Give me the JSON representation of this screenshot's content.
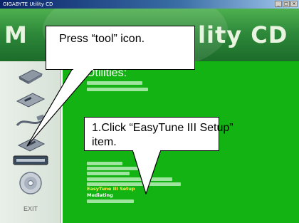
{
  "window": {
    "title": "GIGABYTE Utility CD",
    "buttons": [
      "_",
      "□",
      "×"
    ]
  },
  "banner": {
    "text_left": "M",
    "text_right": "lity CD",
    "colors": {
      "top": "#4fb04f",
      "bottom": "#1c6b2a"
    }
  },
  "sidebar": {
    "items": [
      {
        "name": "drive-icon"
      },
      {
        "name": "disk-icon"
      },
      {
        "name": "cable-icon"
      },
      {
        "name": "tool-icon"
      },
      {
        "name": "readme-icon"
      },
      {
        "name": "cd-icon"
      }
    ],
    "exit_label": "EXIT"
  },
  "content": {
    "title": "Utilities:",
    "accent_colors": {
      "background": "#12b312",
      "link": "#ffee55"
    },
    "menu_items": [
      {
        "label": "EasyTune III Setup",
        "highlighted": true
      },
      {
        "label": "Mediating",
        "highlighted": false
      }
    ]
  },
  "callouts": {
    "tool": "Press “tool” icon.",
    "easytune_line1": "1.Click “EasyTune III Setup”",
    "easytune_line2": "item."
  }
}
